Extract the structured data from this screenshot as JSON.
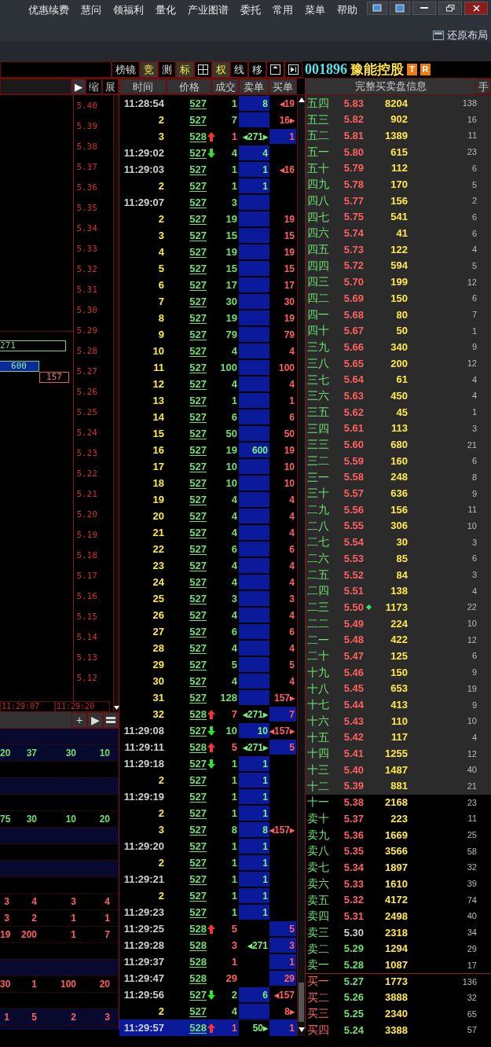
{
  "menu": [
    "优惠续费",
    "慧问",
    "领福利",
    "量化",
    "产业图谱",
    "委托",
    "常用",
    "菜单",
    "帮助"
  ],
  "restore_layout": "还原布局",
  "toolbar": [
    {
      "kind": "text",
      "label": "榜镜",
      "active": false
    },
    {
      "kind": "text",
      "label": "竞",
      "active": true
    },
    {
      "kind": "text",
      "label": "测",
      "active": false
    },
    {
      "kind": "text",
      "label": "标",
      "active": true
    },
    {
      "kind": "grid",
      "active": false
    },
    {
      "kind": "text",
      "label": "权",
      "active": true
    },
    {
      "kind": "text",
      "label": "线",
      "active": false
    },
    {
      "kind": "text",
      "label": "移",
      "active": false
    },
    {
      "kind": "panel",
      "active": false
    },
    {
      "kind": "next",
      "active": false
    }
  ],
  "stock": {
    "code": "001896",
    "name": "豫能控股",
    "badges": [
      "T",
      "R"
    ]
  },
  "left_header": {
    "buttons": [
      "▶",
      "缩",
      "展"
    ]
  },
  "chart": {
    "price_axis": [
      "5.40",
      "5.39",
      "5.38",
      "5.37",
      "5.36",
      "5.35",
      "5.34",
      "5.33",
      "5.32",
      "5.31",
      "5.30",
      "5.29",
      "5.28",
      "5.27",
      "5.26",
      "5.25",
      "5.24",
      "5.23",
      "5.22",
      "5.21",
      "5.20",
      "5.19",
      "5.18",
      "5.17",
      "5.16",
      "5.15",
      "5.14",
      "5.13",
      "5.12"
    ],
    "blocks": [
      {
        "label": "271",
        "kind": "ask"
      },
      {
        "label": "600",
        "kind": "filled"
      },
      {
        "label": "157",
        "kind": "bid"
      }
    ],
    "time_axis": [
      "11:29:07",
      "11:29:20"
    ]
  },
  "left_tools": [
    "+",
    "▶"
  ],
  "left_table": [
    {
      "shaded": true
    },
    {
      "shaded": true,
      "buy": false,
      "cells": [
        "20",
        "37",
        "30",
        "10"
      ]
    },
    {
      "shaded": false
    },
    {
      "shaded": true
    },
    {
      "shaded": false
    },
    {
      "shaded": false,
      "buy": false,
      "cells": [
        "75",
        "30",
        "10",
        "20"
      ]
    },
    {
      "shaded": true
    },
    {
      "shaded": false
    },
    {
      "shaded": true
    },
    {
      "shaded": false
    },
    {
      "shaded": false,
      "buy": true,
      "cells": [
        "3",
        "4",
        "3",
        "4"
      ]
    },
    {
      "shaded": false,
      "buy": true,
      "cells": [
        "3",
        "2",
        "1",
        "1"
      ]
    },
    {
      "shaded": false,
      "buy": true,
      "cells": [
        "19",
        "200",
        "1",
        "7"
      ]
    },
    {
      "shaded": false
    },
    {
      "shaded": true
    },
    {
      "shaded": false,
      "buy": true,
      "cells": [
        "30",
        "1",
        "100",
        "20"
      ]
    },
    {
      "shaded": false
    },
    {
      "shaded": true,
      "buy": true,
      "cells": [
        "1",
        "5",
        "2",
        "3"
      ]
    },
    {
      "shaded": true
    }
  ],
  "ticks": {
    "columns": [
      "时间",
      "价格",
      "成交",
      "卖单",
      "买单"
    ],
    "rows": [
      {
        "time": "11:28:54",
        "kind": "time",
        "price": "527",
        "uptick": false,
        "downtick": false,
        "volume": "1",
        "buy": false,
        "sell_order": "8",
        "sell_fill": true,
        "buy_order": "◂19",
        "buy_fill": false,
        "selected": false
      },
      {
        "time": "2",
        "kind": "seq",
        "price": "527",
        "uptick": false,
        "downtick": false,
        "volume": "7",
        "buy": false,
        "sell_fill": true,
        "buy_order": "16▸",
        "buy_fill": false,
        "selected": false
      },
      {
        "time": "3",
        "kind": "seq",
        "price": "528",
        "uptick": true,
        "downtick": false,
        "volume": "1",
        "buy": true,
        "sell_order": "◂271▸",
        "sell_fill": false,
        "buy_order": "1",
        "buy_fill": true,
        "selected": false
      },
      {
        "time": "11:29:02",
        "kind": "time",
        "price": "527",
        "uptick": false,
        "downtick": true,
        "volume": "4",
        "buy": false,
        "sell_order": "4",
        "sell_fill": true,
        "buy_fill": false,
        "selected": false
      },
      {
        "time": "11:29:03",
        "kind": "time",
        "price": "527",
        "uptick": false,
        "downtick": false,
        "volume": "1",
        "buy": false,
        "sell_order": "1",
        "sell_fill": true,
        "buy_order": "◂16",
        "buy_fill": false,
        "selected": false
      },
      {
        "time": "2",
        "kind": "seq",
        "price": "527",
        "uptick": false,
        "downtick": false,
        "volume": "1",
        "buy": false,
        "sell_order": "1",
        "sell_fill": true,
        "buy_fill": false,
        "selected": false
      },
      {
        "time": "11:29:07",
        "kind": "time",
        "price": "527",
        "uptick": false,
        "downtick": false,
        "volume": "3",
        "buy": false,
        "sell_fill": true,
        "buy_fill": false,
        "selected": false
      },
      {
        "time": "2",
        "kind": "seq",
        "price": "527",
        "uptick": false,
        "downtick": false,
        "volume": "19",
        "buy": false,
        "sell_fill": true,
        "buy_order": "19",
        "buy_fill": false,
        "selected": false
      },
      {
        "time": "3",
        "kind": "seq",
        "price": "527",
        "uptick": false,
        "downtick": false,
        "volume": "15",
        "buy": false,
        "sell_fill": true,
        "buy_order": "15",
        "buy_fill": false,
        "selected": false
      },
      {
        "time": "4",
        "kind": "seq",
        "price": "527",
        "uptick": false,
        "downtick": false,
        "volume": "19",
        "buy": false,
        "sell_fill": true,
        "buy_order": "19",
        "buy_fill": false,
        "selected": false
      },
      {
        "time": "5",
        "kind": "seq",
        "price": "527",
        "uptick": false,
        "downtick": false,
        "volume": "15",
        "buy": false,
        "sell_fill": true,
        "buy_order": "15",
        "buy_fill": false,
        "selected": false
      },
      {
        "time": "6",
        "kind": "seq",
        "price": "527",
        "uptick": false,
        "downtick": false,
        "volume": "17",
        "buy": false,
        "sell_fill": true,
        "buy_order": "17",
        "buy_fill": false,
        "selected": false
      },
      {
        "time": "7",
        "kind": "seq",
        "price": "527",
        "uptick": false,
        "downtick": false,
        "volume": "30",
        "buy": false,
        "sell_fill": true,
        "buy_order": "30",
        "buy_fill": false,
        "selected": false
      },
      {
        "time": "8",
        "kind": "seq",
        "price": "527",
        "uptick": false,
        "downtick": false,
        "volume": "19",
        "buy": false,
        "sell_fill": true,
        "buy_order": "19",
        "buy_fill": false,
        "selected": false
      },
      {
        "time": "9",
        "kind": "seq",
        "price": "527",
        "uptick": false,
        "downtick": false,
        "volume": "79",
        "buy": false,
        "sell_fill": true,
        "buy_order": "79",
        "buy_fill": false,
        "selected": false
      },
      {
        "time": "10",
        "kind": "seq",
        "price": "527",
        "uptick": false,
        "downtick": false,
        "volume": "4",
        "buy": false,
        "sell_fill": true,
        "buy_order": "4",
        "buy_fill": false,
        "selected": false
      },
      {
        "time": "11",
        "kind": "seq",
        "price": "527",
        "uptick": false,
        "downtick": false,
        "volume": "100",
        "buy": false,
        "sell_fill": true,
        "buy_order": "100",
        "buy_fill": false,
        "selected": false
      },
      {
        "time": "12",
        "kind": "seq",
        "price": "527",
        "uptick": false,
        "downtick": false,
        "volume": "4",
        "buy": false,
        "sell_fill": true,
        "buy_order": "4",
        "buy_fill": false,
        "selected": false
      },
      {
        "time": "13",
        "kind": "seq",
        "price": "527",
        "uptick": false,
        "downtick": false,
        "volume": "1",
        "buy": false,
        "sell_fill": true,
        "buy_order": "1",
        "buy_fill": false,
        "selected": false
      },
      {
        "time": "14",
        "kind": "seq",
        "price": "527",
        "uptick": false,
        "downtick": false,
        "volume": "6",
        "buy": false,
        "sell_fill": true,
        "buy_order": "6",
        "buy_fill": false,
        "selected": false
      },
      {
        "time": "15",
        "kind": "seq",
        "price": "527",
        "uptick": false,
        "downtick": false,
        "volume": "50",
        "buy": false,
        "sell_fill": true,
        "buy_order": "50",
        "buy_fill": false,
        "selected": false
      },
      {
        "time": "16",
        "kind": "seq",
        "price": "527",
        "uptick": false,
        "downtick": false,
        "volume": "19",
        "buy": false,
        "sell_order": "600",
        "sell_fill": true,
        "buy_order": "19",
        "buy_fill": false,
        "selected": false
      },
      {
        "time": "17",
        "kind": "seq",
        "price": "527",
        "uptick": false,
        "downtick": false,
        "volume": "10",
        "buy": false,
        "sell_fill": true,
        "buy_order": "10",
        "buy_fill": false,
        "selected": false
      },
      {
        "time": "18",
        "kind": "seq",
        "price": "527",
        "uptick": false,
        "downtick": false,
        "volume": "10",
        "buy": false,
        "sell_fill": true,
        "buy_order": "10",
        "buy_fill": false,
        "selected": false
      },
      {
        "time": "19",
        "kind": "seq",
        "price": "527",
        "uptick": false,
        "downtick": false,
        "volume": "4",
        "buy": false,
        "sell_fill": true,
        "buy_order": "4",
        "buy_fill": false,
        "selected": false
      },
      {
        "time": "20",
        "kind": "seq",
        "price": "527",
        "uptick": false,
        "downtick": false,
        "volume": "4",
        "buy": false,
        "sell_fill": true,
        "buy_order": "4",
        "buy_fill": false,
        "selected": false
      },
      {
        "time": "21",
        "kind": "seq",
        "price": "527",
        "uptick": false,
        "downtick": false,
        "volume": "4",
        "buy": false,
        "sell_fill": true,
        "buy_order": "4",
        "buy_fill": false,
        "selected": false
      },
      {
        "time": "22",
        "kind": "seq",
        "price": "527",
        "uptick": false,
        "downtick": false,
        "volume": "6",
        "buy": false,
        "sell_fill": true,
        "buy_order": "6",
        "buy_fill": false,
        "selected": false
      },
      {
        "time": "23",
        "kind": "seq",
        "price": "527",
        "uptick": false,
        "downtick": false,
        "volume": "4",
        "buy": false,
        "sell_fill": true,
        "buy_order": "4",
        "buy_fill": false,
        "selected": false
      },
      {
        "time": "24",
        "kind": "seq",
        "price": "527",
        "uptick": false,
        "downtick": false,
        "volume": "4",
        "buy": false,
        "sell_fill": true,
        "buy_order": "4",
        "buy_fill": false,
        "selected": false
      },
      {
        "time": "25",
        "kind": "seq",
        "price": "527",
        "uptick": false,
        "downtick": false,
        "volume": "3",
        "buy": false,
        "sell_fill": true,
        "buy_order": "3",
        "buy_fill": false,
        "selected": false
      },
      {
        "time": "26",
        "kind": "seq",
        "price": "527",
        "uptick": false,
        "downtick": false,
        "volume": "4",
        "buy": false,
        "sell_fill": true,
        "buy_order": "4",
        "buy_fill": false,
        "selected": false
      },
      {
        "time": "27",
        "kind": "seq",
        "price": "527",
        "uptick": false,
        "downtick": false,
        "volume": "6",
        "buy": false,
        "sell_fill": true,
        "buy_order": "6",
        "buy_fill": false,
        "selected": false
      },
      {
        "time": "28",
        "kind": "seq",
        "price": "527",
        "uptick": false,
        "downtick": false,
        "volume": "4",
        "buy": false,
        "sell_fill": true,
        "buy_order": "4",
        "buy_fill": false,
        "selected": false
      },
      {
        "time": "29",
        "kind": "seq",
        "price": "527",
        "uptick": false,
        "downtick": false,
        "volume": "5",
        "buy": false,
        "sell_fill": true,
        "buy_order": "5",
        "buy_fill": false,
        "selected": false
      },
      {
        "time": "30",
        "kind": "seq",
        "price": "527",
        "uptick": false,
        "downtick": false,
        "volume": "4",
        "buy": false,
        "sell_fill": true,
        "buy_order": "4",
        "buy_fill": false,
        "selected": false
      },
      {
        "time": "31",
        "kind": "seq",
        "price": "527",
        "uptick": false,
        "downtick": false,
        "volume": "128",
        "buy": false,
        "sell_fill": true,
        "buy_order": "157▸",
        "buy_fill": false,
        "selected": false
      },
      {
        "time": "32",
        "kind": "seq",
        "price": "528",
        "uptick": true,
        "downtick": false,
        "volume": "7",
        "buy": true,
        "sell_order": "◂271▸",
        "sell_fill": false,
        "buy_order": "7",
        "buy_fill": true,
        "selected": false
      },
      {
        "time": "11:29:08",
        "kind": "time",
        "price": "527",
        "uptick": false,
        "downtick": true,
        "volume": "10",
        "buy": false,
        "sell_order": "10",
        "sell_fill": true,
        "buy_order": "◂157▸",
        "buy_fill": false,
        "selected": false
      },
      {
        "time": "11:29:11",
        "kind": "time",
        "price": "528",
        "uptick": true,
        "downtick": false,
        "volume": "5",
        "buy": true,
        "sell_order": "◂271▸",
        "sell_fill": false,
        "buy_order": "5",
        "buy_fill": true,
        "selected": false
      },
      {
        "time": "11:29:18",
        "kind": "time",
        "price": "527",
        "uptick": false,
        "downtick": true,
        "volume": "1",
        "buy": false,
        "sell_order": "1",
        "sell_fill": true,
        "buy_fill": false,
        "selected": false
      },
      {
        "time": "2",
        "kind": "seq",
        "price": "527",
        "uptick": false,
        "downtick": false,
        "volume": "1",
        "buy": false,
        "sell_order": "1",
        "sell_fill": true,
        "buy_fill": false,
        "selected": false
      },
      {
        "time": "11:29:19",
        "kind": "time",
        "price": "527",
        "uptick": false,
        "downtick": false,
        "volume": "1",
        "buy": false,
        "sell_order": "1",
        "sell_fill": true,
        "buy_fill": false,
        "selected": false
      },
      {
        "time": "2",
        "kind": "seq",
        "price": "527",
        "uptick": false,
        "downtick": false,
        "volume": "1",
        "buy": false,
        "sell_order": "1",
        "sell_fill": true,
        "buy_fill": false,
        "selected": false
      },
      {
        "time": "3",
        "kind": "seq",
        "price": "527",
        "uptick": false,
        "downtick": false,
        "volume": "8",
        "buy": false,
        "sell_order": "8",
        "sell_fill": true,
        "buy_order": "◂157▸",
        "buy_fill": false,
        "selected": false
      },
      {
        "time": "11:29:20",
        "kind": "time",
        "price": "527",
        "uptick": false,
        "downtick": false,
        "volume": "1",
        "buy": false,
        "sell_order": "1",
        "sell_fill": true,
        "buy_fill": false,
        "selected": false
      },
      {
        "time": "2",
        "kind": "seq",
        "price": "527",
        "uptick": false,
        "downtick": false,
        "volume": "1",
        "buy": false,
        "sell_order": "1",
        "sell_fill": true,
        "buy_fill": false,
        "selected": false
      },
      {
        "time": "11:29:21",
        "kind": "time",
        "price": "527",
        "uptick": false,
        "downtick": false,
        "volume": "1",
        "buy": false,
        "sell_order": "1",
        "sell_fill": true,
        "buy_fill": false,
        "selected": false
      },
      {
        "time": "2",
        "kind": "seq",
        "price": "527",
        "uptick": false,
        "downtick": false,
        "volume": "1",
        "buy": false,
        "sell_order": "1",
        "sell_fill": true,
        "buy_fill": false,
        "selected": false
      },
      {
        "time": "11:29:23",
        "kind": "time",
        "price": "527",
        "uptick": false,
        "downtick": false,
        "volume": "1",
        "buy": false,
        "sell_order": "1",
        "sell_fill": true,
        "buy_fill": false,
        "selected": false
      },
      {
        "time": "11:29:25",
        "kind": "time",
        "price": "528",
        "uptick": true,
        "downtick": false,
        "volume": "5",
        "buy": true,
        "sell_fill": false,
        "buy_order": "5",
        "buy_fill": true,
        "selected": false
      },
      {
        "time": "11:29:28",
        "kind": "time",
        "price": "528",
        "uptick": false,
        "downtick": false,
        "volume": "3",
        "buy": true,
        "sell_order": "◂271",
        "sell_fill": false,
        "buy_order": "3",
        "buy_fill": true,
        "selected": false
      },
      {
        "time": "11:29:37",
        "kind": "time",
        "price": "528",
        "uptick": false,
        "downtick": false,
        "volume": "1",
        "buy": true,
        "sell_fill": false,
        "buy_order": "1",
        "buy_fill": true,
        "selected": false
      },
      {
        "time": "11:29:47",
        "kind": "time",
        "price": "528",
        "uptick": false,
        "downtick": false,
        "volume": "29",
        "buy": true,
        "sell_fill": false,
        "buy_order": "29",
        "buy_fill": true,
        "selected": false
      },
      {
        "time": "11:29:56",
        "kind": "time",
        "price": "527",
        "uptick": false,
        "downtick": true,
        "volume": "2",
        "buy": false,
        "sell_order": "6",
        "sell_fill": true,
        "buy_order": "◂157",
        "buy_fill": false,
        "selected": false
      },
      {
        "time": "2",
        "kind": "seq",
        "price": "527",
        "uptick": false,
        "downtick": false,
        "volume": "4",
        "buy": false,
        "sell_fill": true,
        "buy_order": "8▸",
        "buy_fill": false,
        "selected": false
      },
      {
        "time": "11:29:57",
        "kind": "time",
        "price": "528",
        "uptick": true,
        "downtick": false,
        "volume": "1",
        "buy": true,
        "sell_order": "50▸",
        "sell_fill": false,
        "buy_order": "1",
        "buy_fill": false,
        "selected": true
      }
    ]
  },
  "book": {
    "title": "完整买卖盘信息",
    "hand": "手",
    "levels": [
      {
        "label": "五四",
        "bid": false,
        "price": "5.83",
        "kind": "up",
        "volume": "8204",
        "count": "138",
        "shaded": true,
        "marker": false
      },
      {
        "label": "五三",
        "bid": false,
        "price": "5.82",
        "kind": "up",
        "volume": "902",
        "count": "16",
        "shaded": true,
        "marker": false
      },
      {
        "label": "五二",
        "bid": false,
        "price": "5.81",
        "kind": "up",
        "volume": "1389",
        "count": "11",
        "shaded": true,
        "marker": false
      },
      {
        "label": "五一",
        "bid": false,
        "price": "5.80",
        "kind": "up",
        "volume": "615",
        "count": "23",
        "shaded": true,
        "marker": false
      },
      {
        "label": "五十",
        "bid": false,
        "price": "5.79",
        "kind": "up",
        "volume": "112",
        "count": "6",
        "shaded": true,
        "marker": false
      },
      {
        "label": "四九",
        "bid": false,
        "price": "5.78",
        "kind": "up",
        "volume": "170",
        "count": "5",
        "shaded": true,
        "marker": false
      },
      {
        "label": "四八",
        "bid": false,
        "price": "5.77",
        "kind": "up",
        "volume": "156",
        "count": "2",
        "shaded": true,
        "marker": false
      },
      {
        "label": "四七",
        "bid": false,
        "price": "5.75",
        "kind": "up",
        "volume": "541",
        "count": "6",
        "shaded": true,
        "marker": false
      },
      {
        "label": "四六",
        "bid": false,
        "price": "5.74",
        "kind": "up",
        "volume": "41",
        "count": "6",
        "shaded": true,
        "marker": false
      },
      {
        "label": "四五",
        "bid": false,
        "price": "5.73",
        "kind": "up",
        "volume": "122",
        "count": "4",
        "shaded": true,
        "marker": false
      },
      {
        "label": "四四",
        "bid": false,
        "price": "5.72",
        "kind": "up",
        "volume": "594",
        "count": "5",
        "shaded": true,
        "marker": false
      },
      {
        "label": "四三",
        "bid": false,
        "price": "5.70",
        "kind": "up",
        "volume": "199",
        "count": "12",
        "shaded": true,
        "marker": false
      },
      {
        "label": "四二",
        "bid": false,
        "price": "5.69",
        "kind": "up",
        "volume": "150",
        "count": "6",
        "shaded": true,
        "marker": false
      },
      {
        "label": "四一",
        "bid": false,
        "price": "5.68",
        "kind": "up",
        "volume": "80",
        "count": "7",
        "shaded": true,
        "marker": false
      },
      {
        "label": "四十",
        "bid": false,
        "price": "5.67",
        "kind": "up",
        "volume": "50",
        "count": "1",
        "shaded": true,
        "marker": false
      },
      {
        "label": "三九",
        "bid": false,
        "price": "5.66",
        "kind": "up",
        "volume": "340",
        "count": "9",
        "shaded": true,
        "marker": false
      },
      {
        "label": "三八",
        "bid": false,
        "price": "5.65",
        "kind": "up",
        "volume": "200",
        "count": "12",
        "shaded": true,
        "marker": false
      },
      {
        "label": "三七",
        "bid": false,
        "price": "5.64",
        "kind": "up",
        "volume": "61",
        "count": "4",
        "shaded": true,
        "marker": false
      },
      {
        "label": "三六",
        "bid": false,
        "price": "5.63",
        "kind": "up",
        "volume": "450",
        "count": "4",
        "shaded": true,
        "marker": false
      },
      {
        "label": "三五",
        "bid": false,
        "price": "5.62",
        "kind": "up",
        "volume": "45",
        "count": "1",
        "shaded": true,
        "marker": false
      },
      {
        "label": "三四",
        "bid": false,
        "price": "5.61",
        "kind": "up",
        "volume": "113",
        "count": "3",
        "shaded": true,
        "marker": false
      },
      {
        "label": "三三",
        "bid": false,
        "price": "5.60",
        "kind": "up",
        "volume": "680",
        "count": "21",
        "shaded": true,
        "marker": false
      },
      {
        "label": "三二",
        "bid": false,
        "price": "5.59",
        "kind": "up",
        "volume": "160",
        "count": "6",
        "shaded": true,
        "marker": false
      },
      {
        "label": "三一",
        "bid": false,
        "price": "5.58",
        "kind": "up",
        "volume": "248",
        "count": "8",
        "shaded": true,
        "marker": false
      },
      {
        "label": "三十",
        "bid": false,
        "price": "5.57",
        "kind": "up",
        "volume": "636",
        "count": "9",
        "shaded": true,
        "marker": false
      },
      {
        "label": "二九",
        "bid": false,
        "price": "5.56",
        "kind": "up",
        "volume": "156",
        "count": "11",
        "shaded": true,
        "marker": false
      },
      {
        "label": "二八",
        "bid": false,
        "price": "5.55",
        "kind": "up",
        "volume": "306",
        "count": "10",
        "shaded": true,
        "marker": false
      },
      {
        "label": "二七",
        "bid": false,
        "price": "5.54",
        "kind": "up",
        "volume": "30",
        "count": "3",
        "shaded": true,
        "marker": false
      },
      {
        "label": "二六",
        "bid": false,
        "price": "5.53",
        "kind": "up",
        "volume": "85",
        "count": "6",
        "shaded": true,
        "marker": false
      },
      {
        "label": "二五",
        "bid": false,
        "price": "5.52",
        "kind": "up",
        "volume": "84",
        "count": "3",
        "shaded": true,
        "marker": false
      },
      {
        "label": "二四",
        "bid": false,
        "price": "5.51",
        "kind": "up",
        "volume": "138",
        "count": "4",
        "shaded": true,
        "marker": false
      },
      {
        "label": "二三",
        "bid": false,
        "price": "5.50",
        "kind": "up",
        "volume": "1173",
        "count": "22",
        "shaded": true,
        "marker": true
      },
      {
        "label": "二二",
        "bid": false,
        "price": "5.49",
        "kind": "up",
        "volume": "224",
        "count": "10",
        "shaded": true,
        "marker": false
      },
      {
        "label": "二一",
        "bid": false,
        "price": "5.48",
        "kind": "up",
        "volume": "422",
        "count": "12",
        "shaded": true,
        "marker": false
      },
      {
        "label": "二十",
        "bid": false,
        "price": "5.47",
        "kind": "up",
        "volume": "125",
        "count": "6",
        "shaded": true,
        "marker": false
      },
      {
        "label": "十九",
        "bid": false,
        "price": "5.46",
        "kind": "up",
        "volume": "150",
        "count": "9",
        "shaded": true,
        "marker": false
      },
      {
        "label": "十八",
        "bid": false,
        "price": "5.45",
        "kind": "up",
        "volume": "653",
        "count": "19",
        "shaded": true,
        "marker": false
      },
      {
        "label": "十七",
        "bid": false,
        "price": "5.44",
        "kind": "up",
        "volume": "413",
        "count": "9",
        "shaded": true,
        "marker": false
      },
      {
        "label": "十六",
        "bid": false,
        "price": "5.43",
        "kind": "up",
        "volume": "110",
        "count": "10",
        "shaded": true,
        "marker": false
      },
      {
        "label": "十五",
        "bid": false,
        "price": "5.42",
        "kind": "up",
        "volume": "117",
        "count": "4",
        "shaded": true,
        "marker": false
      },
      {
        "label": "十四",
        "bid": false,
        "price": "5.41",
        "kind": "up",
        "volume": "1255",
        "count": "12",
        "shaded": true,
        "marker": false
      },
      {
        "label": "十三",
        "bid": false,
        "price": "5.40",
        "kind": "up",
        "volume": "1487",
        "count": "40",
        "shaded": true,
        "marker": false
      },
      {
        "label": "十二",
        "bid": false,
        "price": "5.39",
        "kind": "up",
        "volume": "881",
        "count": "21",
        "shaded": true,
        "marker": false
      },
      {
        "label": "十一",
        "bid": false,
        "price": "5.38",
        "kind": "up",
        "volume": "2168",
        "count": "23",
        "shaded": false,
        "marker": false
      },
      {
        "label": "卖十",
        "bid": false,
        "price": "5.37",
        "kind": "up",
        "volume": "223",
        "count": "11",
        "shaded": false,
        "marker": false
      },
      {
        "label": "卖九",
        "bid": false,
        "price": "5.36",
        "kind": "up",
        "volume": "1669",
        "count": "25",
        "shaded": false,
        "marker": false
      },
      {
        "label": "卖八",
        "bid": false,
        "price": "5.35",
        "kind": "up",
        "volume": "3566",
        "count": "58",
        "shaded": false,
        "marker": false
      },
      {
        "label": "卖七",
        "bid": false,
        "price": "5.34",
        "kind": "up",
        "volume": "1897",
        "count": "32",
        "shaded": false,
        "marker": false
      },
      {
        "label": "卖六",
        "bid": false,
        "price": "5.33",
        "kind": "up",
        "volume": "1610",
        "count": "39",
        "shaded": false,
        "marker": false
      },
      {
        "label": "卖五",
        "bid": false,
        "price": "5.32",
        "kind": "up",
        "volume": "4172",
        "count": "74",
        "shaded": false,
        "marker": false
      },
      {
        "label": "卖四",
        "bid": false,
        "price": "5.31",
        "kind": "up",
        "volume": "2498",
        "count": "40",
        "shaded": false,
        "marker": false
      },
      {
        "label": "卖三",
        "bid": false,
        "price": "5.30",
        "kind": "flat",
        "volume": "2318",
        "count": "34",
        "shaded": false,
        "marker": false
      },
      {
        "label": "卖二",
        "bid": false,
        "price": "5.29",
        "kind": "down",
        "volume": "1294",
        "count": "29",
        "shaded": false,
        "marker": false
      },
      {
        "label": "卖一",
        "bid": false,
        "price": "5.28",
        "kind": "down",
        "volume": "1087",
        "count": "17",
        "shaded": false,
        "marker": false
      },
      {
        "label": "买一",
        "bid": true,
        "price": "5.27",
        "kind": "down",
        "volume": "1773",
        "count": "136",
        "shaded": false,
        "marker": false
      },
      {
        "label": "买二",
        "bid": true,
        "price": "5.26",
        "kind": "down",
        "volume": "3888",
        "count": "32",
        "shaded": false,
        "marker": false
      },
      {
        "label": "买三",
        "bid": true,
        "price": "5.25",
        "kind": "down",
        "volume": "2340",
        "count": "65",
        "shaded": false,
        "marker": false
      },
      {
        "label": "买四",
        "bid": true,
        "price": "5.24",
        "kind": "down",
        "volume": "3388",
        "count": "57",
        "shaded": false,
        "marker": false
      }
    ]
  }
}
